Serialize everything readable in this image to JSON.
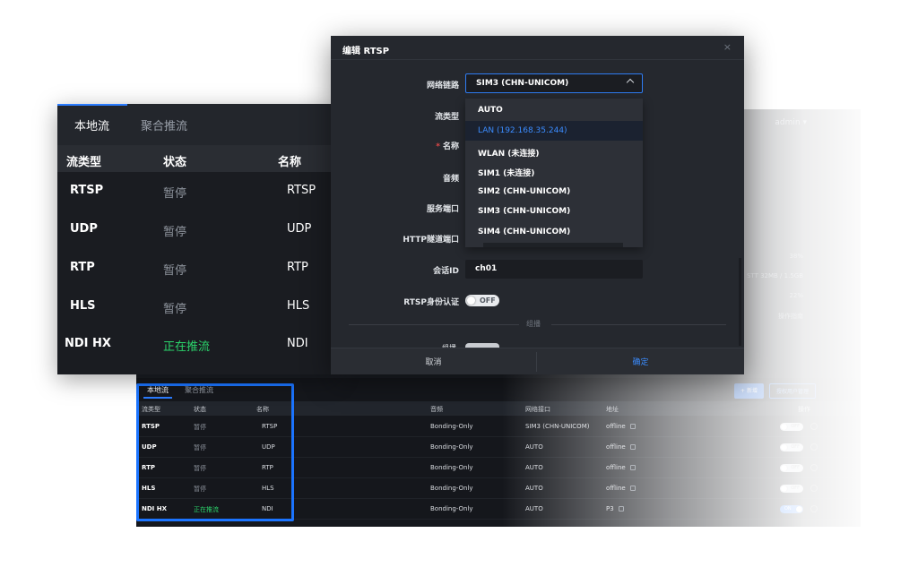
{
  "bg_window": {
    "user_label": "admin ▾",
    "right_values": [
      "38%",
      "STT 32MB / 1.5GB",
      "22%",
      "操作指南"
    ],
    "tabs": [
      "本地流",
      "聚合推流"
    ],
    "buttons": {
      "add": "+ 新增",
      "restore": "授权用户管理"
    },
    "columns": [
      "流类型",
      "状态",
      "名称",
      "音频",
      "网络接口",
      "地址",
      "操作"
    ],
    "rows": [
      {
        "type": "RTSP",
        "state": "暂停",
        "name": "RTSP",
        "audio": "Bonding-Only",
        "iface": "SIM3 (CHN-UNICOM)",
        "addr": "offline",
        "toggle": "OFF",
        "live": false
      },
      {
        "type": "UDP",
        "state": "暂停",
        "name": "UDP",
        "audio": "Bonding-Only",
        "iface": "AUTO",
        "addr": "offline",
        "toggle": "OFF",
        "live": false
      },
      {
        "type": "RTP",
        "state": "暂停",
        "name": "RTP",
        "audio": "Bonding-Only",
        "iface": "AUTO",
        "addr": "offline",
        "toggle": "OFF",
        "live": false
      },
      {
        "type": "HLS",
        "state": "暂停",
        "name": "HLS",
        "audio": "Bonding-Only",
        "iface": "AUTO",
        "addr": "offline",
        "toggle": "OFF",
        "live": false
      },
      {
        "type": "NDI HX",
        "state": "正在推流",
        "name": "NDI",
        "audio": "Bonding-Only",
        "iface": "AUTO",
        "addr": "P3",
        "toggle": "ON",
        "live": true
      }
    ]
  },
  "zoom_panel": {
    "tabs": [
      "本地流",
      "聚合推流"
    ],
    "columns": [
      "流类型",
      "状态",
      "名称"
    ],
    "rows": [
      {
        "type": "RTSP",
        "state": "暂停",
        "name": "RTSP"
      },
      {
        "type": "UDP",
        "state": "暂停",
        "name": "UDP"
      },
      {
        "type": "RTP",
        "state": "暂停",
        "name": "RTP"
      },
      {
        "type": "HLS",
        "state": "暂停",
        "name": "HLS"
      },
      {
        "type": "NDI HX",
        "state": "正在推流",
        "name": "NDI"
      }
    ]
  },
  "modal": {
    "title": "编辑 RTSP",
    "close": "×",
    "labels": {
      "network": "网络链路",
      "stream_type": "流类型",
      "name": "名称",
      "name_required": "*",
      "audio": "音频",
      "service_port": "服务端口",
      "http_port": "HTTP隧道端口",
      "session_id": "会话ID",
      "rtsp_auth": "RTSP身份认证",
      "peek_label": "组播"
    },
    "network_selected": "SIM3 (CHN-UNICOM)",
    "network_options": [
      "AUTO",
      "LAN (192.168.35.244)",
      "WLAN (未连接)",
      "SIM1 (未连接)",
      "SIM2 (CHN-UNICOM)",
      "SIM3 (CHN-UNICOM)",
      "SIM4 (CHN-UNICOM)"
    ],
    "highlighted_option": "LAN (192.168.35.244)",
    "session_id_value": "ch01",
    "rtsp_auth_toggle": "OFF",
    "section_divider": "组播",
    "cancel": "取消",
    "ok": "确定"
  },
  "colors": {
    "accent": "#2b7cff",
    "live_green": "#2bd46b",
    "highlight_border": "#1b74ff",
    "panel_bg": "#1a1c21",
    "modal_bg": "#25282e"
  }
}
